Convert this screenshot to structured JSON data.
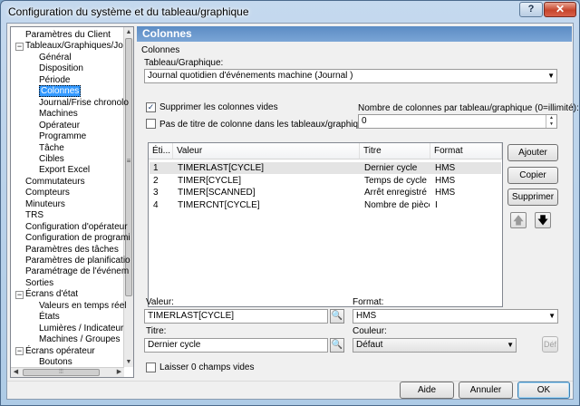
{
  "window": {
    "title": "Configuration du système et du tableau/graphique",
    "help_glyph": "?",
    "close_glyph": "✕"
  },
  "tree": {
    "items": [
      {
        "label": "Paramètres du Client",
        "level": 0
      },
      {
        "label": "Tableaux/Graphiques/Jo",
        "level": 0,
        "expander": "−"
      },
      {
        "label": "Général",
        "level": 1
      },
      {
        "label": "Disposition",
        "level": 1
      },
      {
        "label": "Période",
        "level": 1
      },
      {
        "label": "Colonnes",
        "level": 1,
        "selected": true
      },
      {
        "label": "Journal/Frise chronolo",
        "level": 1
      },
      {
        "label": "Machines",
        "level": 1
      },
      {
        "label": "Opérateur",
        "level": 1
      },
      {
        "label": "Programme",
        "level": 1
      },
      {
        "label": "Tâche",
        "level": 1
      },
      {
        "label": "Cibles",
        "level": 1
      },
      {
        "label": "Export Excel",
        "level": 1
      },
      {
        "label": "Commutateurs",
        "level": 0
      },
      {
        "label": "Compteurs",
        "level": 0
      },
      {
        "label": "Minuteurs",
        "level": 0
      },
      {
        "label": "TRS",
        "level": 0
      },
      {
        "label": "Configuration d'opérateur",
        "level": 0
      },
      {
        "label": "Configuration de programi",
        "level": 0
      },
      {
        "label": "Paramètres des tâches",
        "level": 0
      },
      {
        "label": "Paramètres de planificatio",
        "level": 0
      },
      {
        "label": "Paramétrage de l'événem",
        "level": 0
      },
      {
        "label": "Sorties",
        "level": 0
      },
      {
        "label": "Écrans d'état",
        "level": 0,
        "expander": "−"
      },
      {
        "label": "Valeurs en temps réel",
        "level": 1
      },
      {
        "label": "États",
        "level": 1
      },
      {
        "label": "Lumières / Indicateur",
        "level": 1
      },
      {
        "label": "Machines / Groupes",
        "level": 1
      },
      {
        "label": "Écrans opérateur",
        "level": 0,
        "expander": "−"
      },
      {
        "label": "Boutons",
        "level": 1
      }
    ]
  },
  "panel": {
    "header": "Colonnes",
    "section_label": "Colonnes",
    "chart_label": "Tableau/Graphique:",
    "chart_value": "Journal quotidien d'événements machine  (Journal )",
    "suppress_empty_label": "Supprimer les colonnes vides",
    "suppress_empty_checked": true,
    "no_title_label": "Pas de titre de colonne dans les tableaux/graphiques",
    "no_title_checked": false,
    "num_cols_label": "Nombre de colonnes par tableau/graphique (0=illimité):",
    "num_cols_value": "0"
  },
  "table": {
    "headers": [
      "Éti...",
      "Valeur",
      "Titre",
      "Format"
    ],
    "rows": [
      [
        "1",
        "TIMERLAST[CYCLE]",
        "Dernier cycle",
        "HMS"
      ],
      [
        "2",
        "TIMER[CYCLE]",
        "Temps de cycle",
        "HMS"
      ],
      [
        "3",
        "TIMER[SCANNED]",
        "Arrêt enregistré",
        "HMS"
      ],
      [
        "4",
        "TIMERCNT[CYCLE]",
        "Nombre de pièces",
        "I"
      ]
    ],
    "selected_row": 0
  },
  "side_buttons": {
    "add": "Ajouter",
    "copy": "Copier",
    "delete": "Supprimer"
  },
  "editor": {
    "value_label": "Valeur:",
    "value": "TIMERLAST[CYCLE]",
    "format_label": "Format:",
    "format_value": "HMS",
    "title_label": "Titre:",
    "title_value": "Dernier cycle",
    "color_label": "Couleur:",
    "color_value": "Défaut",
    "def_button": "Déf",
    "zero_fields_label": "Laisser 0 champs vides",
    "zero_fields_checked": false
  },
  "footer": {
    "help": "Aide",
    "cancel": "Annuler",
    "ok": "OK"
  },
  "colors": {
    "accent_header": "#5c8cc4",
    "selection": "#3399ff"
  }
}
